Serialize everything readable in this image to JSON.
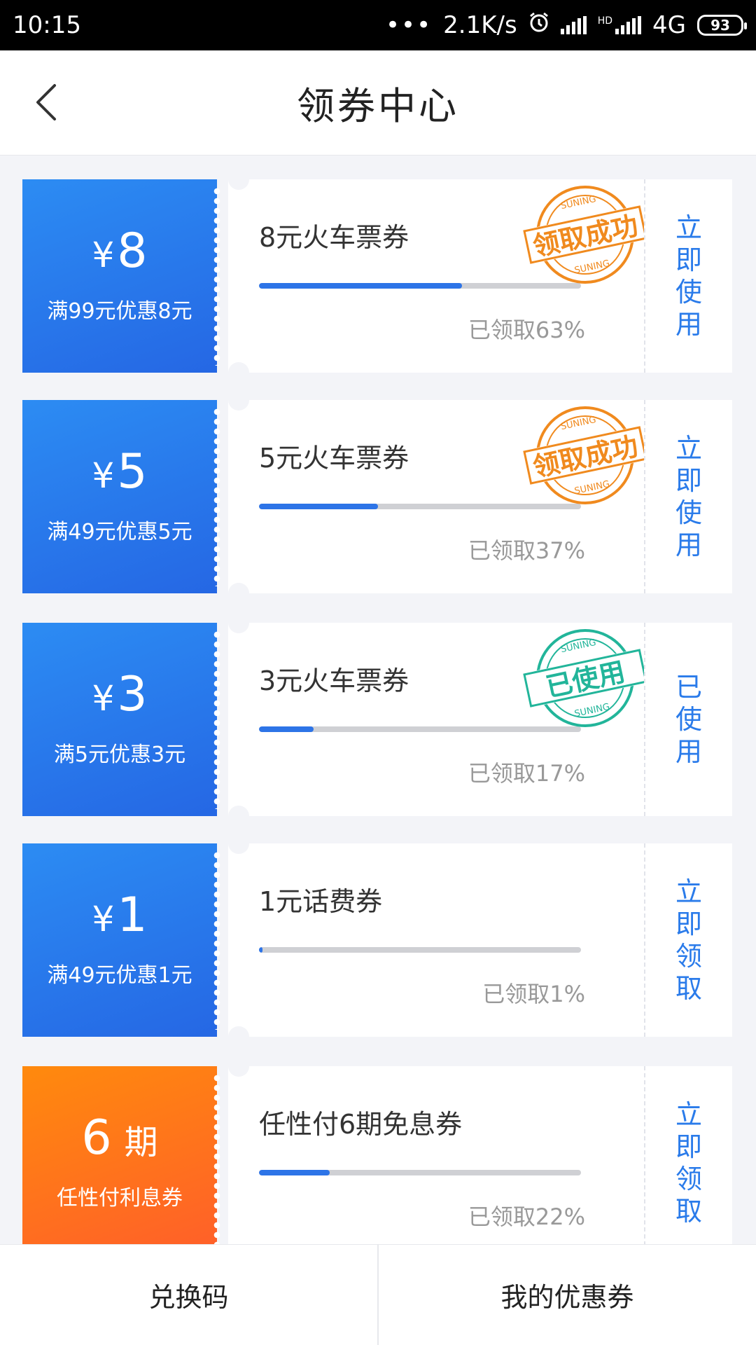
{
  "status_bar": {
    "time": "10:15",
    "dots": "•••",
    "net_speed": "2.1K/s",
    "network": "4G",
    "hd": "HD",
    "battery": "93"
  },
  "header": {
    "title": "领券中心"
  },
  "coupons": [
    {
      "amount": "8",
      "currency": "¥",
      "condition": "满99元优惠8元",
      "name": "8元火车票券",
      "claimed_fraction": 0.63,
      "claimed_text": "已领取63%",
      "action": "立即使用",
      "stamp": {
        "text": "领取成功",
        "brand": "SUNING",
        "color": "#f08a1e"
      }
    },
    {
      "amount": "5",
      "currency": "¥",
      "condition": "满49元优惠5元",
      "name": "5元火车票券",
      "claimed_fraction": 0.37,
      "claimed_text": "已领取37%",
      "action": "立即使用",
      "stamp": {
        "text": "领取成功",
        "brand": "SUNING",
        "color": "#f08a1e"
      }
    },
    {
      "amount": "3",
      "currency": "¥",
      "condition": "满5元优惠3元",
      "name": "3元火车票券",
      "claimed_fraction": 0.17,
      "claimed_text": "已领取17%",
      "action": "已使用",
      "stamp": {
        "text": "已使用",
        "brand": "SUNING",
        "color": "#22b59a"
      }
    },
    {
      "amount": "1",
      "currency": "¥",
      "condition": "满49元优惠1元",
      "name": "1元话费券",
      "claimed_fraction": 0.01,
      "claimed_text": "已领取1%",
      "action": "立即领取",
      "stamp": null
    },
    {
      "amount": "6",
      "unit": "期",
      "condition": "任性付利息券",
      "name": "任性付6期免息券",
      "claimed_fraction": 0.22,
      "claimed_text": "已领取22%",
      "action": "立即领取",
      "stamp": null
    }
  ],
  "bottom_tabs": {
    "redeem_code": "兑换码",
    "my_coupons": "我的优惠券"
  },
  "colors": {
    "primary_blue": "#2a7bea",
    "coupon_blue": "#2567e4",
    "coupon_orange": "#ff6a20",
    "stamp_orange": "#f08a1e",
    "stamp_green": "#22b59a"
  }
}
